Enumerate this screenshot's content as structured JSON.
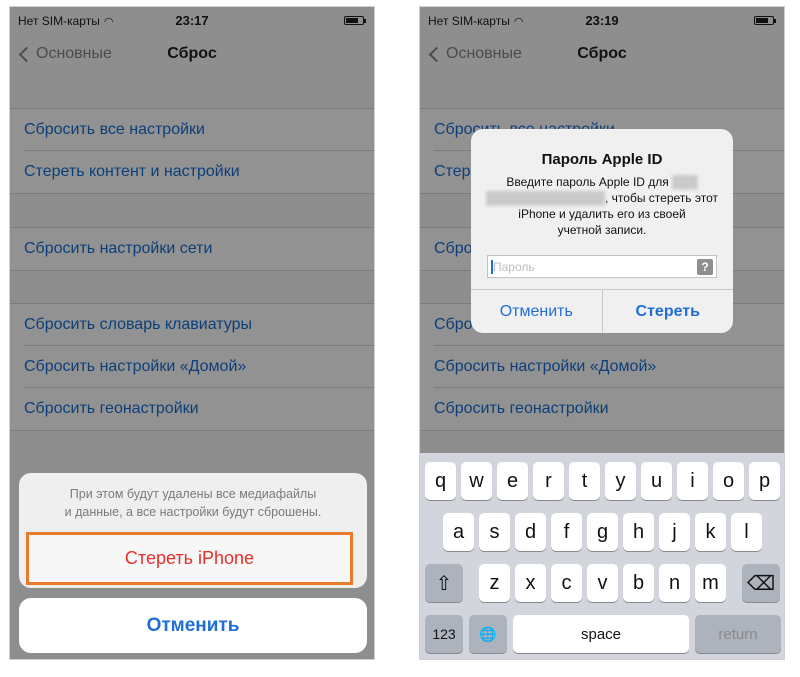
{
  "phone1": {
    "status": {
      "carrier": "Нет SIM-карты",
      "time": "23:17"
    },
    "nav": {
      "back": "Основные",
      "title": "Сброс"
    },
    "group1": [
      "Сбросить все настройки",
      "Стереть контент и настройки"
    ],
    "group2": [
      "Сбросить настройки сети"
    ],
    "group3": [
      "Сбросить словарь клавиатуры",
      "Сбросить настройки «Домой»",
      "Сбросить геонастройки"
    ],
    "sheet": {
      "message_line1": "При этом будут удалены все медиафайлы",
      "message_line2": "и данные, а все настройки будут сброшены.",
      "destructive": "Стереть iPhone",
      "cancel": "Отменить"
    }
  },
  "phone2": {
    "status": {
      "carrier": "Нет SIM-карты",
      "time": "23:19"
    },
    "nav": {
      "back": "Основные",
      "title": "Сброс"
    },
    "bg_rows": [
      "Сбросить все настройки",
      "Стер",
      "Сбро",
      "Сбро",
      "Сбросить настройки «Домой»",
      "Сбросить геонастройки"
    ],
    "alert": {
      "title": "Пароль Apple ID",
      "msg_line1": "Введите пароль Apple ID для",
      "msg_line2": ", чтобы стереть этот",
      "msg_line3": "iPhone и удалить его из своей",
      "msg_line4": "учетной записи.",
      "placeholder": "Пароль",
      "help": "?",
      "cancel": "Отменить",
      "confirm": "Стереть"
    },
    "keyboard": {
      "row1": [
        "q",
        "w",
        "e",
        "r",
        "t",
        "y",
        "u",
        "i",
        "o",
        "p"
      ],
      "row2": [
        "a",
        "s",
        "d",
        "f",
        "g",
        "h",
        "j",
        "k",
        "l"
      ],
      "row3": [
        "z",
        "x",
        "c",
        "v",
        "b",
        "n",
        "m"
      ],
      "shift": "⇧",
      "delete": "⌫",
      "numbers": "123",
      "globe": "🌐",
      "space": "space",
      "return": "return"
    }
  },
  "colors": {
    "link": "#0c3f79",
    "accent": "#1f6ed6",
    "destructive": "#e8302a",
    "highlight": "#e87b2d"
  }
}
